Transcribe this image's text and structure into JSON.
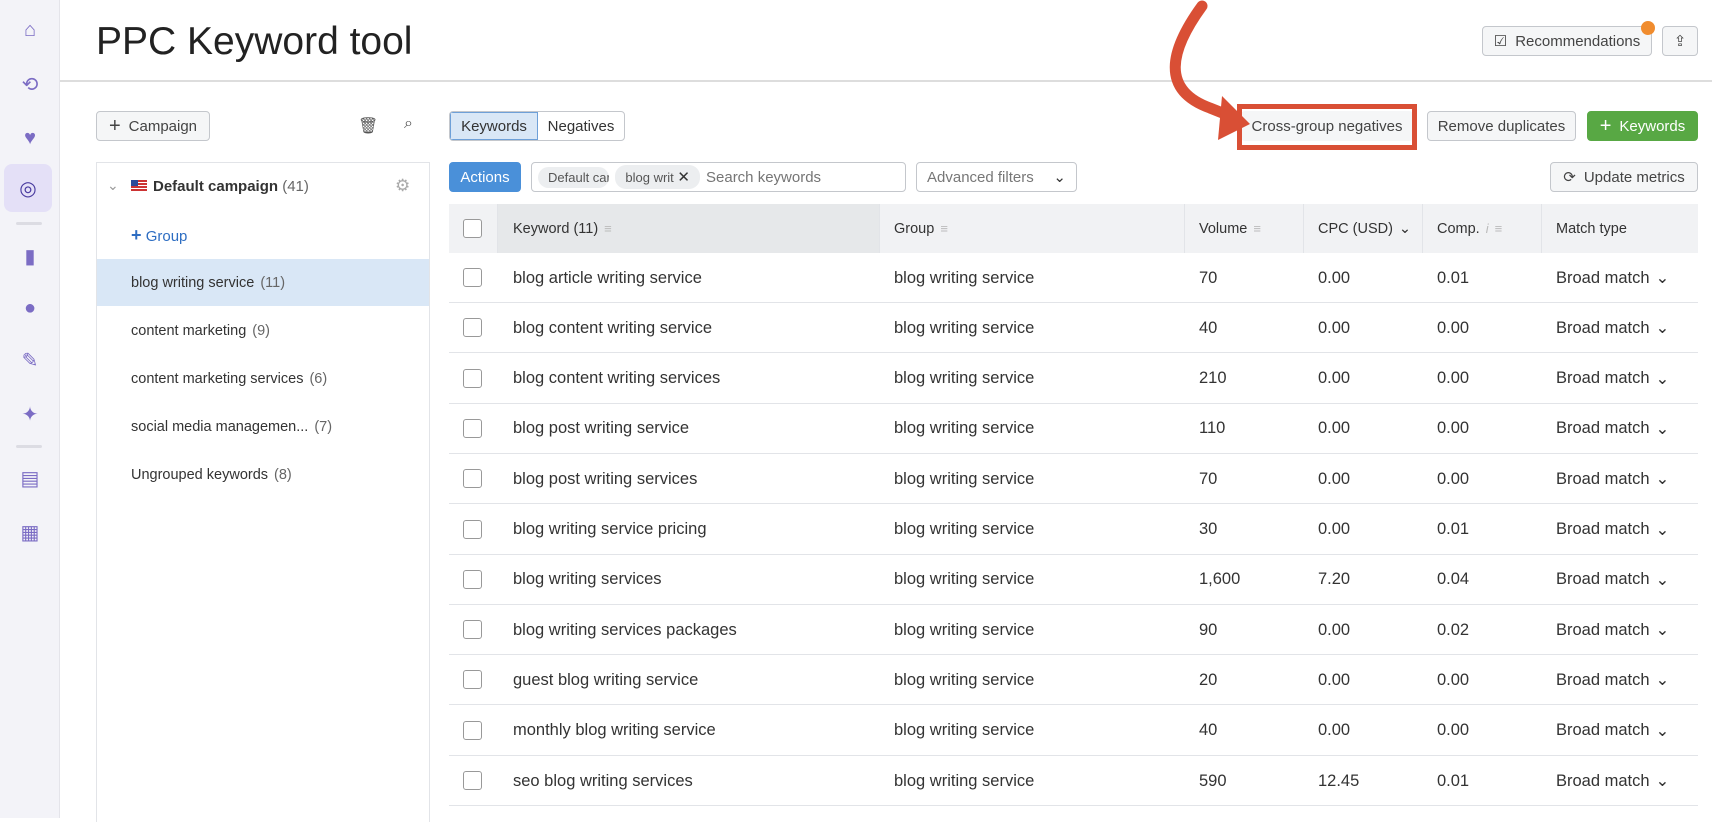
{
  "page": {
    "title": "PPC Keyword tool"
  },
  "header": {
    "recommendations_label": "Recommendations",
    "notification_dot_color": "#f08c2e"
  },
  "left_panel": {
    "add_campaign_label": "Campaign",
    "campaign": {
      "name": "Default campaign",
      "count": "(41)",
      "flag": "us-flag"
    },
    "add_group_label": "Group",
    "groups": [
      {
        "label": "blog writing service",
        "count": "(11)",
        "selected": true
      },
      {
        "label": "content marketing",
        "count": "(9)"
      },
      {
        "label": "content marketing services",
        "count": "(6)"
      },
      {
        "label": "social media managemen...",
        "count": "(7)"
      },
      {
        "label": "Ungrouped keywords",
        "count": "(8)"
      }
    ]
  },
  "toolbar": {
    "tabs": [
      "Keywords",
      "Negatives"
    ],
    "active_tab": "Keywords",
    "cross_group_label": "Cross-group negatives",
    "remove_duplicates_label": "Remove duplicates",
    "add_keywords_label": "Keywords",
    "actions_label": "Actions",
    "filter_chips": [
      "Default campa",
      "blog writ"
    ],
    "search_placeholder": "Search keywords",
    "advanced_filters_label": "Advanced filters",
    "update_metrics_label": "Update metrics"
  },
  "annotation": {
    "color": "#d94f35"
  },
  "table": {
    "columns": [
      "Keyword (11)",
      "Group",
      "Volume",
      "CPC (USD)",
      "Comp.",
      "Match type"
    ],
    "rows": [
      [
        "blog article writing service",
        "blog writing service",
        "70",
        "0.00",
        "0.01",
        "Broad match"
      ],
      [
        "blog content writing service",
        "blog writing service",
        "40",
        "0.00",
        "0.00",
        "Broad match"
      ],
      [
        "blog content writing services",
        "blog writing service",
        "210",
        "0.00",
        "0.00",
        "Broad match"
      ],
      [
        "blog post writing service",
        "blog writing service",
        "110",
        "0.00",
        "0.00",
        "Broad match"
      ],
      [
        "blog post writing services",
        "blog writing service",
        "70",
        "0.00",
        "0.00",
        "Broad match"
      ],
      [
        "blog writing service pricing",
        "blog writing service",
        "30",
        "0.00",
        "0.01",
        "Broad match"
      ],
      [
        "blog writing services",
        "blog writing service",
        "1,600",
        "7.20",
        "0.04",
        "Broad match"
      ],
      [
        "blog writing services packages",
        "blog writing service",
        "90",
        "0.00",
        "0.02",
        "Broad match"
      ],
      [
        "guest blog writing service",
        "blog writing service",
        "20",
        "0.00",
        "0.00",
        "Broad match"
      ],
      [
        "monthly blog writing service",
        "blog writing service",
        "40",
        "0.00",
        "0.00",
        "Broad match"
      ],
      [
        "seo blog writing services",
        "blog writing service",
        "590",
        "12.45",
        "0.01",
        "Broad match"
      ]
    ]
  }
}
